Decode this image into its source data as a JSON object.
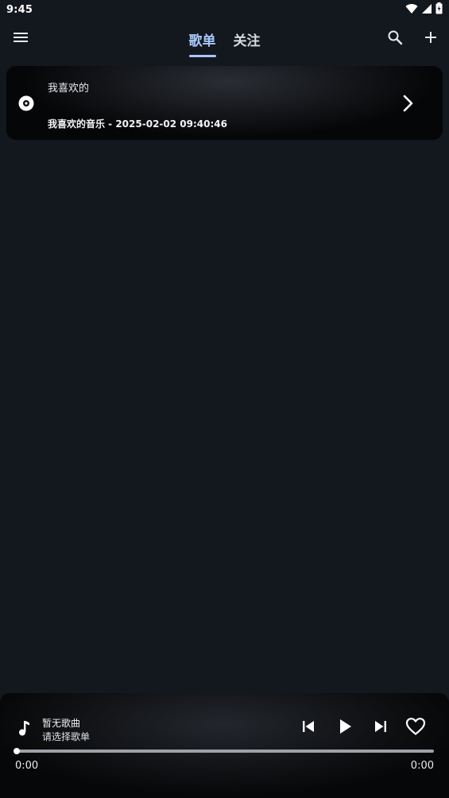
{
  "status_bar": {
    "time": "9:45",
    "icons": [
      "wifi-icon",
      "signal-icon",
      "battery-icon"
    ]
  },
  "top_bar": {
    "tabs": [
      {
        "label": "歌单",
        "active": true
      },
      {
        "label": "关注",
        "active": false
      }
    ],
    "icons": [
      "menu-icon",
      "search-icon",
      "add-icon"
    ]
  },
  "playlist": {
    "title": "我喜欢的",
    "subtitle": "我喜欢的音乐 - 2025-02-02 09:40:46",
    "icon": "disc-icon",
    "action_icon": "chevron-right-icon"
  },
  "player": {
    "song_title": "暂无歌曲",
    "song_subtitle": "请选择歌单",
    "current_time": "0:00",
    "total_time": "0:00",
    "progress": 0,
    "icons": [
      "music-note-icon",
      "skip-previous-icon",
      "play-icon",
      "skip-next-icon",
      "heart-icon"
    ]
  },
  "colors": {
    "background": "#13171e",
    "accent": "#a8c7fa",
    "text": "#ffffff"
  }
}
